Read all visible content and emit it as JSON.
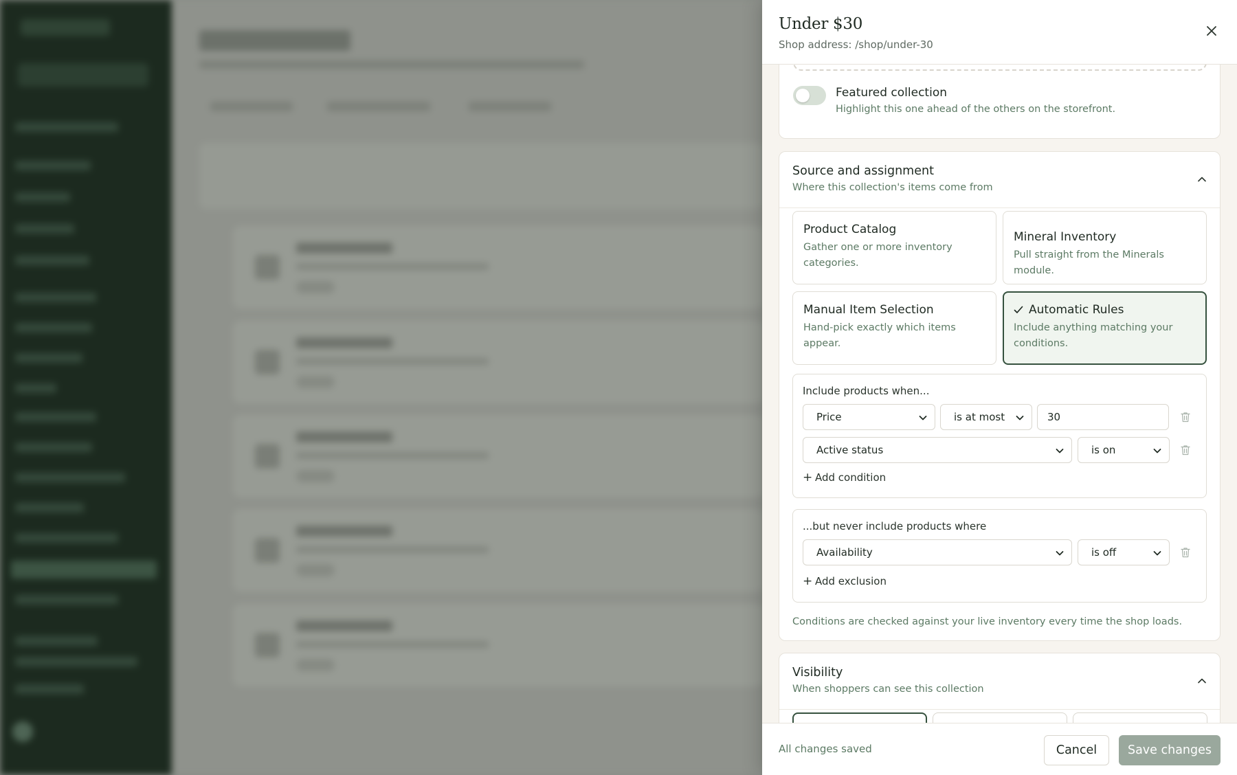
{
  "drawer": {
    "title": "Under $30",
    "subtitle": "Shop address: /shop/under-30",
    "close_icon": "close-icon"
  },
  "featured": {
    "label": "Featured collection",
    "help": "Highlight this one ahead of the others on the storefront.",
    "enabled": false
  },
  "source": {
    "title": "Source and assignment",
    "subtitle": "Where this collection's items come from",
    "options": [
      {
        "title": "Product Catalog",
        "desc": "Gather one or more inventory categories.",
        "selected": false
      },
      {
        "title": "Mineral Inventory",
        "desc": "Pull straight from the Minerals module.",
        "selected": false
      },
      {
        "title": "Manual Item Selection",
        "desc": "Hand-pick exactly which items appear.",
        "selected": false
      },
      {
        "title": "Automatic Rules",
        "desc": "Include anything matching your conditions.",
        "selected": true
      }
    ],
    "include": {
      "label": "Include products when...",
      "conditions": [
        {
          "field": "Price",
          "operator": "is at most",
          "value": "30"
        },
        {
          "field": "Active status",
          "operator": "is on"
        }
      ],
      "add_label": "Add condition"
    },
    "exclude": {
      "label": "...but never include products where",
      "conditions": [
        {
          "field": "Availability",
          "operator": "is off"
        }
      ],
      "add_label": "Add exclusion"
    },
    "note": "Conditions are checked against your live inventory every time the shop loads."
  },
  "visibility": {
    "title": "Visibility",
    "subtitle": "When shoppers can see this collection"
  },
  "footer": {
    "status": "All changes saved",
    "cancel_label": "Cancel",
    "save_label": "Save changes"
  },
  "colors": {
    "accent": "#35513e",
    "muted_text": "#5c7a64",
    "save_disabled": "#9aa89d"
  }
}
